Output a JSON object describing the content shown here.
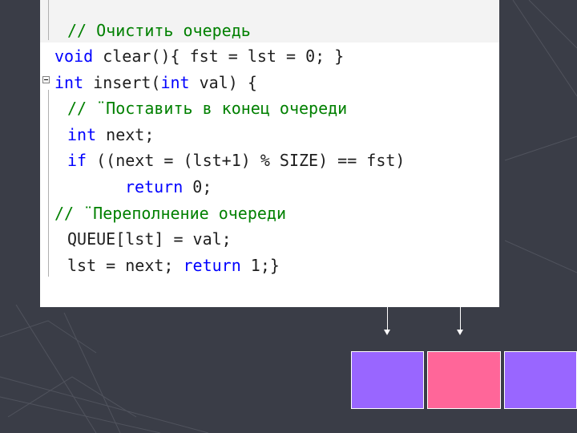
{
  "code": {
    "line1_comment": "// Очистить очередь",
    "line2": {
      "kw": "void",
      "rest": " clear(){ fst = lst = 0; }"
    },
    "line3": {
      "kw1": "int",
      "mid": " insert(",
      "kw2": "int",
      "rest": " val) {"
    },
    "line4_comment": "// ¨Поставить в конец очереди",
    "line5": {
      "kw": "int",
      "rest": " next;"
    },
    "line6": {
      "kw": "if",
      "rest": " ((next = (lst+1) % SIZE) == fst)"
    },
    "line7": {
      "kw": "return",
      "rest": " 0;"
    },
    "line8_comment": "// ¨Переполнение очереди",
    "line9": "QUEUE[lst] = val;",
    "line10": {
      "pre": "lst = next; ",
      "kw": "return",
      "rest": " 1;}"
    }
  },
  "colors": {
    "keyword": "#0000ff",
    "comment": "#008000",
    "cell_purple": "#9966ff",
    "cell_pink": "#ff6699",
    "background": "#3a3d47"
  }
}
